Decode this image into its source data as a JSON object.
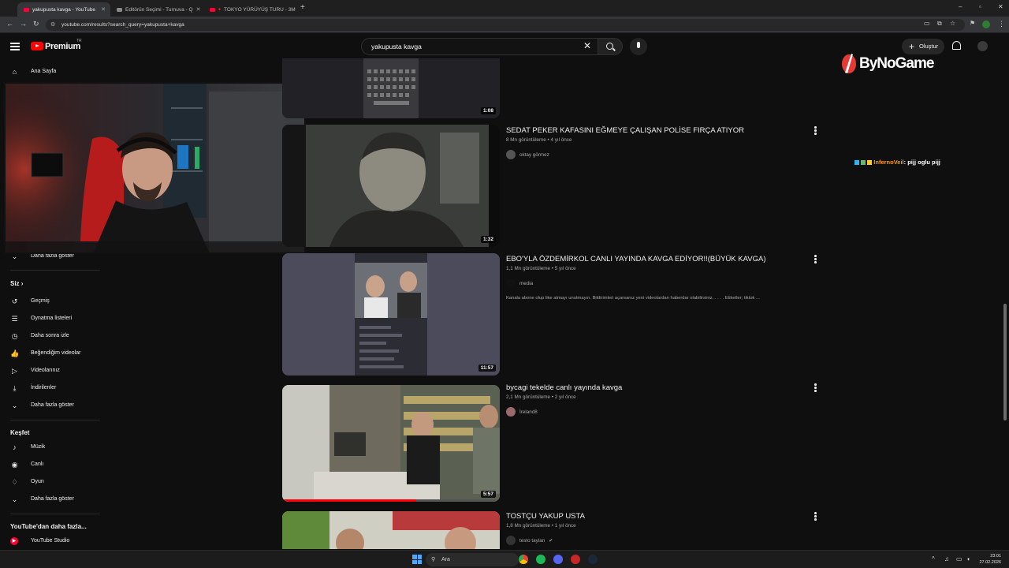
{
  "browser": {
    "tabs": [
      {
        "label": "yakupusta kavga - YouTube",
        "active": true
      },
      {
        "label": "Editörün Seçimi - Turnuva - Q",
        "active": false
      },
      {
        "label": "TOKYO YÜRÜYÜŞ TURU - 3M",
        "active": false
      }
    ],
    "url": "youtube.com/results?search_query=yakupusta+kavga"
  },
  "masthead": {
    "brand": "Premium",
    "region": "TR",
    "search_value": "yakupusta kavga",
    "create_label": "Oluştur"
  },
  "sidebar": {
    "home": "Ana Sayfa",
    "more_collapsed": "Daha fazla göster",
    "you_header": "Siz",
    "you_items": [
      "Geçmiş",
      "Oynatma listeleri",
      "Daha sonra izle",
      "Beğendiğim videolar",
      "Videolarınız",
      "İndirilenler",
      "Daha fazla göster"
    ],
    "explore_header": "Keşfet",
    "explore_items": [
      "Müzik",
      "Canlı",
      "Oyun",
      "Daha fazla göster"
    ],
    "more_from_header": "YouTube'dan daha fazla...",
    "studio": "YouTube Studio"
  },
  "results": [
    {
      "title": "",
      "duration": "1:08"
    },
    {
      "title": "SEDAT PEKER KAFASINI EĞMEYE ÇALIŞAN POLİSE FIRÇA ATIYOR",
      "views": "8 Mn görüntüleme",
      "age": "4 yıl önce",
      "channel": "oktay görmez",
      "duration": "1:32"
    },
    {
      "title": "EBO'YLA ÖZDEMİRKOL CANLI YAYINDA KAVGA EDİYOR!!(BÜYÜK KAVGA)",
      "views": "1,1 Mn görüntüleme",
      "age": "5 yıl önce",
      "channel": "media",
      "description": "Kanala abone olup like atmayı unutmayın. Bildirimleri açarsanız yeni videolardan haberdar olabilirsiniz. . . . . Etiketler; tiktok ...",
      "duration": "11:57"
    },
    {
      "title": "bycagi tekelde canlı yayında kavga",
      "views": "2,1 Mn görüntüleme",
      "age": "2 yıl önce",
      "channel": "İreland8",
      "duration": "5:57"
    },
    {
      "title": "TOSTÇU YAKUP USTA",
      "views": "1,8 Mn görüntüleme",
      "age": "1 yıl önce",
      "channel": "testo taylan"
    }
  ],
  "overlay": {
    "sponsor": "ByNoGame",
    "chat_user": "InfernoVeil",
    "chat_text": ": pijj oglu pijj"
  },
  "taskbar": {
    "search_placeholder": "Ara",
    "time": "23:01",
    "date": "27.02.2026"
  }
}
